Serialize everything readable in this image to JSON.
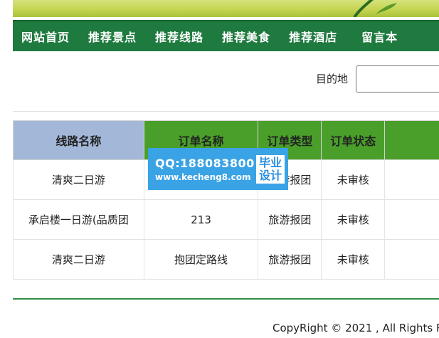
{
  "nav": {
    "items": [
      "网站首页",
      "推荐景点",
      "推荐线路",
      "推荐美食",
      "推荐酒店",
      "留言本"
    ]
  },
  "search": {
    "label": "目的地",
    "value": ""
  },
  "table": {
    "headers": [
      "线路名称",
      "订单名称",
      "订单类型",
      "订单状态",
      ""
    ],
    "rows": [
      [
        "清爽二日游",
        "",
        "旅游报团",
        "未审核",
        ""
      ],
      [
        "承启楼一日游(品质团",
        "213",
        "旅游报团",
        "未审核",
        ""
      ],
      [
        "清爽二日游",
        "抱团定路线",
        "旅游报团",
        "未审核",
        ""
      ]
    ]
  },
  "watermark": {
    "qq": "QQ:188083800",
    "url": "www.kecheng8.com",
    "badge_line1": "毕业",
    "badge_line2": "设计"
  },
  "footer": {
    "copyright": "CopyRight © 2021 , All Rights R"
  },
  "colors": {
    "nav_bg": "#1f7a3f",
    "header_green": "#4a9f2a",
    "header_first": "#a3b8d8",
    "watermark_bg": "#3aa3e6"
  }
}
